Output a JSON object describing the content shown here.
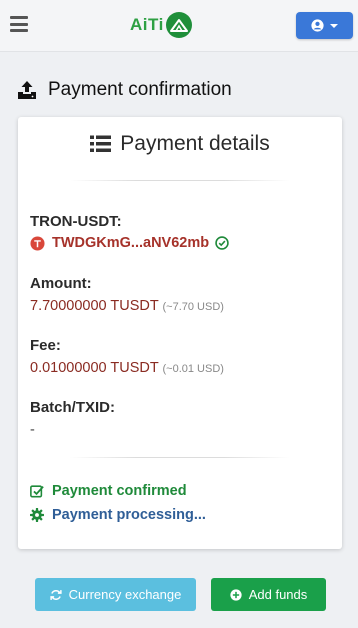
{
  "header": {
    "logo_text": "AiTi",
    "brand_color": "#2ea043",
    "user_button_color": "#3a78d8"
  },
  "page": {
    "title": "Payment confirmation",
    "title_icon": "upload-tray-icon"
  },
  "card": {
    "title": "Payment details",
    "title_icon": "list-icon",
    "currency_label": "TRON-USDT:",
    "address": "TWDGKmG...aNV62mb",
    "address_icon": "tron-icon",
    "address_verified_icon": "check-circle-icon",
    "amount_label": "Amount:",
    "amount_value": "7.70000000 TUSDT",
    "amount_usd": "(~7.70 USD)",
    "fee_label": "Fee:",
    "fee_value": "0.01000000 TUSDT",
    "fee_usd": "(~0.01 USD)",
    "txid_label": "Batch/TXID:",
    "txid_value": "-",
    "status_confirmed": "Payment confirmed",
    "status_confirmed_color": "#1f8a3a",
    "status_processing": "Payment processing...",
    "status_processing_color": "#2f5e97"
  },
  "actions": {
    "exchange_label": "Currency exchange",
    "exchange_icon": "refresh-icon",
    "add_funds_label": "Add funds",
    "add_funds_icon": "plus-circle-icon"
  }
}
